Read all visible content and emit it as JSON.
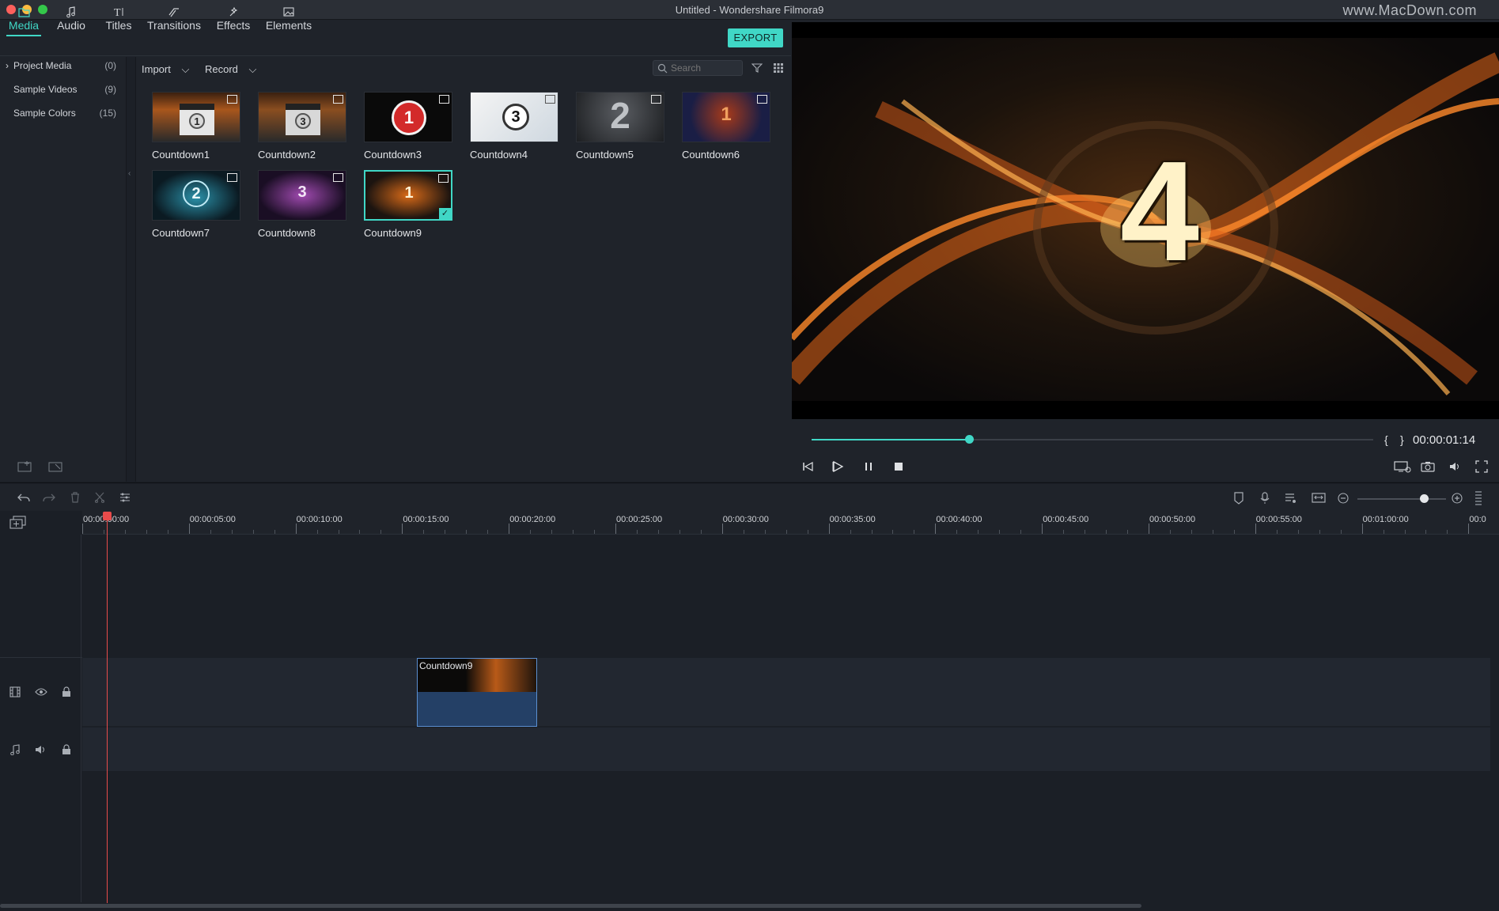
{
  "window": {
    "title": "Untitled - Wondershare Filmora9",
    "watermark": "www.MacDown.com"
  },
  "tabs": [
    {
      "label": "Media",
      "icon": "folder-icon",
      "active": true
    },
    {
      "label": "Audio",
      "icon": "music-note-icon",
      "active": false
    },
    {
      "label": "Titles",
      "icon": "text-icon",
      "active": false
    },
    {
      "label": "Transitions",
      "icon": "transition-icon",
      "active": false
    },
    {
      "label": "Effects",
      "icon": "effects-icon",
      "active": false
    },
    {
      "label": "Elements",
      "icon": "image-icon",
      "active": false
    }
  ],
  "export_label": "EXPORT",
  "sidebar": {
    "items": [
      {
        "label": "Project Media",
        "count": "(0)"
      },
      {
        "label": "Sample Videos",
        "count": "(9)"
      },
      {
        "label": "Sample Colors",
        "count": "(15)"
      }
    ]
  },
  "media_toolbar": {
    "import_label": "Import",
    "record_label": "Record",
    "search_placeholder": "Search"
  },
  "media_items": [
    {
      "label": "Countdown1",
      "num": "1"
    },
    {
      "label": "Countdown2",
      "num": "3"
    },
    {
      "label": "Countdown3",
      "num": "1"
    },
    {
      "label": "Countdown4",
      "num": "3"
    },
    {
      "label": "Countdown5",
      "num": "2"
    },
    {
      "label": "Countdown6",
      "num": "1"
    },
    {
      "label": "Countdown7",
      "num": "2"
    },
    {
      "label": "Countdown8",
      "num": "3"
    },
    {
      "label": "Countdown9",
      "num": "1",
      "selected": true
    }
  ],
  "preview": {
    "big_number": "4",
    "timecode": "00:00:01:14",
    "progress": 0.28
  },
  "timeline": {
    "ruler_labels": [
      "00:00:00:00",
      "00:00:05:00",
      "00:00:10:00",
      "00:00:15:00",
      "00:00:20:00",
      "00:00:25:00",
      "00:00:30:00",
      "00:00:35:00",
      "00:00:40:00",
      "00:00:45:00",
      "00:00:50:00",
      "00:00:55:00",
      "00:01:00:00",
      "00:0"
    ],
    "clip_name": "Countdown9",
    "zoom_level": 0.75
  },
  "colors": {
    "accent": "#40d7c6",
    "playhead": "#e84b4b",
    "clip": "#244066"
  }
}
